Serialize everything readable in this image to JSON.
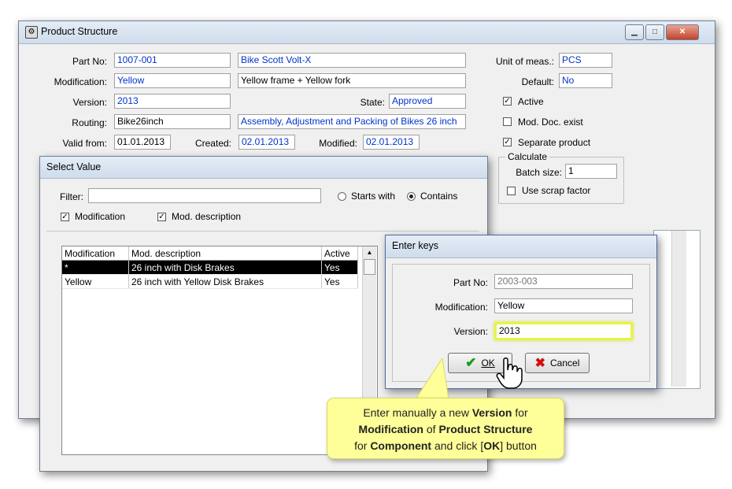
{
  "main_window": {
    "title": "Product Structure",
    "part_no_label": "Part No:",
    "part_no": "1007-001",
    "part_desc": "Bike Scott Volt-X",
    "modification_label": "Modification:",
    "modification": "Yellow",
    "modification_desc": "Yellow frame + Yellow fork",
    "version_label": "Version:",
    "version": "2013",
    "state_label": "State:",
    "state": "Approved",
    "routing_label": "Routing:",
    "routing": "Bike26inch",
    "routing_desc": "Assembly, Adjustment and Packing of Bikes 26 inch",
    "valid_from_label": "Valid from:",
    "valid_from": "01.01.2013",
    "created_label": "Created:",
    "created": "02.01.2013",
    "modified_label": "Modified:",
    "modified": "02.01.2013",
    "uom_label": "Unit of meas.:",
    "uom": "PCS",
    "default_label": "Default:",
    "default": "No",
    "active_label": "Active",
    "mod_doc_label": "Mod. Doc. exist",
    "separate_label": "Separate product",
    "calculate_label": "Calculate",
    "batch_label": "Batch size:",
    "batch": "1",
    "scrap_label": "Use scrap factor"
  },
  "select_dialog": {
    "title": "Select Value",
    "filter_label": "Filter:",
    "filter_value": "",
    "starts_with": "Starts with",
    "contains": "Contains",
    "chk_modification": "Modification",
    "chk_mod_desc": "Mod. description",
    "columns": [
      "Modification",
      "Mod. description",
      "Active"
    ],
    "rows": [
      [
        "*",
        "26 inch with Disk Brakes",
        "Yes"
      ],
      [
        "Yellow",
        "26 inch with Yellow Disk Brakes",
        "Yes"
      ]
    ]
  },
  "enter_keys": {
    "title": "Enter keys",
    "part_no_label": "Part No:",
    "part_no": "2003-003",
    "modification_label": "Modification:",
    "modification": "Yellow",
    "version_label": "Version:",
    "version": "2013",
    "ok_label": "OK",
    "cancel_label": "Cancel"
  },
  "callout": {
    "t1": "Enter manually a new ",
    "b1": "Version",
    "t2": " for",
    "b2": "Modification",
    "t3": " of ",
    "b3": "Product Structure",
    "t4": "for ",
    "b4": "Component",
    "t5": " and click [",
    "b5": "OK",
    "t6": "] button"
  },
  "colors": {
    "accent_blue": "#0033cc",
    "callout_bg": "#ffff9a",
    "highlight": "#e8f34a"
  }
}
